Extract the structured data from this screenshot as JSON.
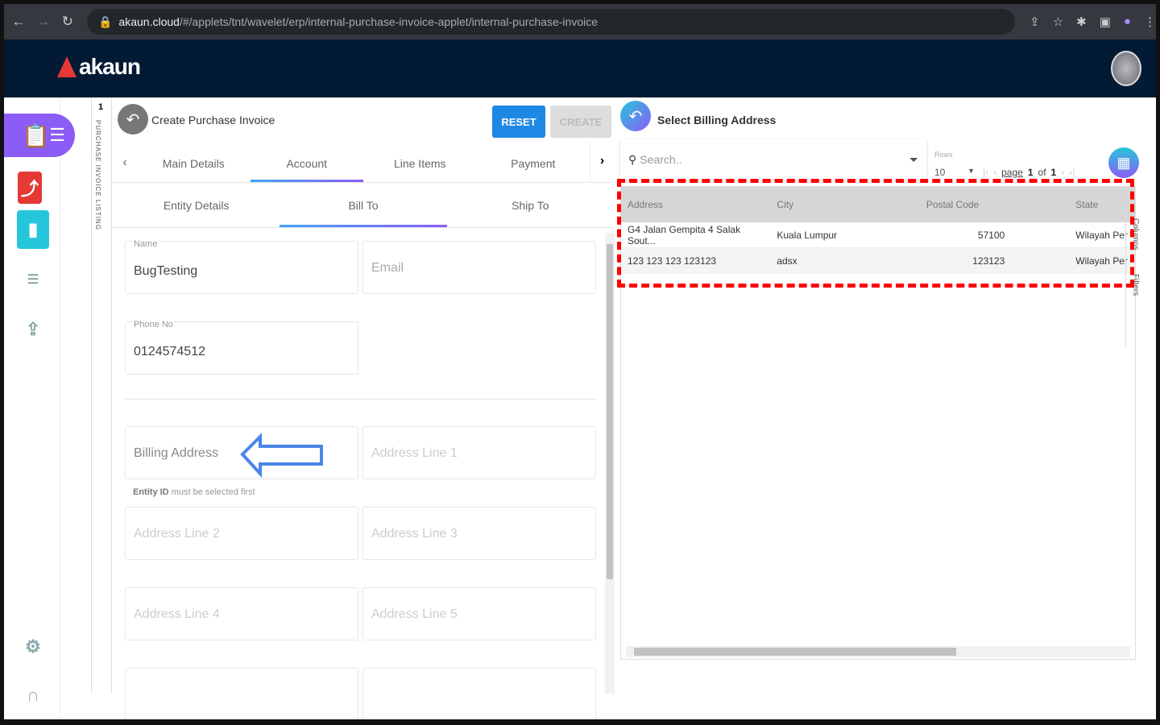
{
  "browser": {
    "url_domain": "akaun.cloud",
    "url_path": "/#/applets/tnt/wavelet/erp/internal-purchase-invoice-applet/internal-purchase-invoice"
  },
  "app": {
    "logo": "akaun"
  },
  "listing": {
    "count": "1",
    "label": "PURCHASE INVOICE LISTING"
  },
  "form": {
    "title": "Create Purchase Invoice",
    "reset": "RESET",
    "create": "CREATE",
    "tabs": [
      "Main Details",
      "Account",
      "Line Items",
      "Payment"
    ],
    "subtabs": [
      "Entity Details",
      "Bill To",
      "Ship To"
    ],
    "name_label": "Name",
    "name_value": "BugTesting",
    "email_ph": "Email",
    "phone_label": "Phone No",
    "phone_value": "0124574512",
    "billing_ph": "Billing Address",
    "addr1": "Address Line 1",
    "hint_bold": "Entity ID",
    "hint_rest": " must be selected first",
    "addr2": "Address Line 2",
    "addr3": "Address Line 3",
    "addr4": "Address Line 4",
    "addr5": "Address Line 5"
  },
  "billing": {
    "title": "Select Billing Address",
    "search_ph": "Search..",
    "rows_label": "Rows",
    "rows_value": "10",
    "page_label": "page",
    "page": "1",
    "of": "of",
    "pages": "1",
    "columns": [
      "Address",
      "City",
      "Postal Code",
      "State"
    ],
    "rows": [
      [
        "G4 Jalan Gempita 4 Salak Sout...",
        "Kuala Lumpur",
        "57100",
        "Wilayah Per"
      ],
      [
        "123 123 123 123123",
        "adsx",
        "123123",
        "Wilayah Per"
      ]
    ],
    "side_tabs": [
      "Columns",
      "Filters"
    ]
  }
}
